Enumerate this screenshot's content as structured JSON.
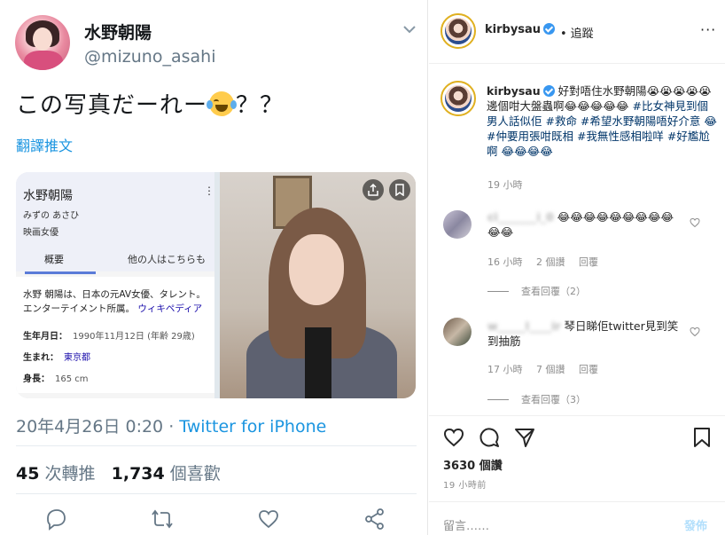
{
  "tweet": {
    "display_name": "水野朝陽",
    "handle": "@mizuno_asahi",
    "text_before_emoji": "この写真だーれー",
    "text_after_emoji": "？？",
    "emoji_icon": "face-with-tears-of-joy-icon",
    "translate_label": "翻譯推文",
    "date": "20年4月26日 0:20 ·",
    "source": "Twitter for iPhone",
    "retweets_count": "45",
    "retweets_label": "次轉推",
    "likes_count": "1,734",
    "likes_label": "個喜歡",
    "accent_color": "#1b95e0",
    "media": {
      "knowledge_panel": {
        "name": "水野朝陽",
        "kana": "みずの あさひ",
        "role": "映画女優",
        "more_dots": "⋮",
        "tab_overview": "概要",
        "tab_others": "他の人はこちらも",
        "description": "水野 朝陽は、日本の元AV女優、タレント。エンターテイメント所属。",
        "wiki_link": "ウィキペディア",
        "birthdate_label": "生年月日：",
        "birthdate_value": "1990年11月12日 (年齢 29歳)",
        "birthplace_label": "生まれ：",
        "birthplace_value": "東京都",
        "height_label": "身長：",
        "height_value": "165 cm"
      }
    }
  },
  "instagram": {
    "username": "kirbysau",
    "follow_label": "追蹤",
    "more_icon": "more-horizontal-icon",
    "more_glyph": "···",
    "caption_text": "好對唔住水野朝陽😭😭😭😭😭邊個咁大盤蟲啊😂😂😂😂😂",
    "caption_tags": "#比女神見到個男人話似佢 #救命 #希望水野朝陽唔好介意 😂 #仲要用張咁既相 #我無性感相啦咩 #好尷尬啊 😂😂😂😂",
    "caption_time": "19 小時",
    "comments": [
      {
        "username": "ci_______i_0",
        "text": "😂😂😂😂😂😂😂😂😂😂😂",
        "time": "16 小時",
        "likes": "2 個讚",
        "reply": "回覆",
        "view_replies": "查看回覆（2）"
      },
      {
        "username": "w_____l____ir",
        "text": "琴日睇佢twitter見到笑到抽筋",
        "time": "17 小時",
        "likes": "7 個讚",
        "reply": "回覆",
        "view_replies": "查看回覆（3）"
      }
    ],
    "likes_count": "3630",
    "likes_label": "個讚",
    "posted_ago": "19 小時前",
    "comment_placeholder": "留言……",
    "post_label": "發佈",
    "verified_color": "#3897f0"
  }
}
